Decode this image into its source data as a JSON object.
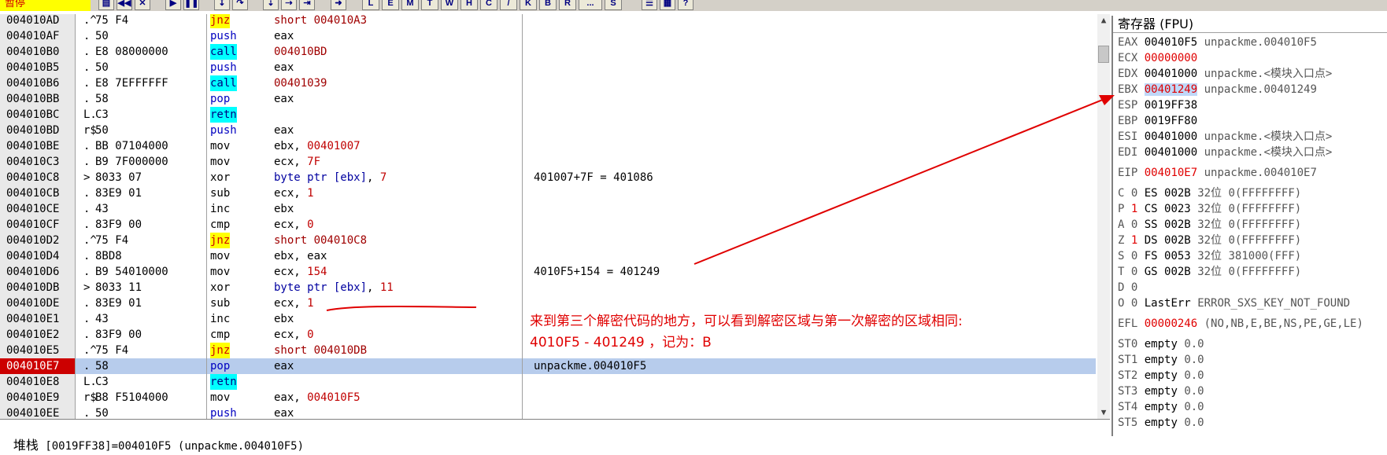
{
  "toolbar": {
    "status": "暂停",
    "letter_buttons": [
      "L",
      "E",
      "M",
      "T",
      "W",
      "H",
      "C",
      "/",
      "K",
      "B",
      "R",
      "...",
      "S"
    ]
  },
  "disasm": {
    "rows": [
      {
        "addr": "004010AD",
        "marker": ".^",
        "bytes": "75 F4",
        "mnem": "jnz",
        "ops": "short 004010A3",
        "comment": ""
      },
      {
        "addr": "004010AF",
        "marker": ".",
        "bytes": "50",
        "mnem": "push",
        "ops": "eax",
        "comment": ""
      },
      {
        "addr": "004010B0",
        "marker": ".",
        "bytes": "E8 08000000",
        "mnem": "call",
        "ops": "004010BD",
        "comment": ""
      },
      {
        "addr": "004010B5",
        "marker": ".",
        "bytes": "50",
        "mnem": "push",
        "ops": "eax",
        "comment": ""
      },
      {
        "addr": "004010B6",
        "marker": ".",
        "bytes": "E8 7EFFFFFF",
        "mnem": "call",
        "ops": "00401039",
        "comment": ""
      },
      {
        "addr": "004010BB",
        "marker": ".",
        "bytes": "58",
        "mnem": "pop",
        "ops": "eax",
        "comment": ""
      },
      {
        "addr": "004010BC",
        "marker": "L.",
        "bytes": "C3",
        "mnem": "retn",
        "ops": "",
        "comment": ""
      },
      {
        "addr": "004010BD",
        "marker": "r$",
        "bytes": "50",
        "mnem": "push",
        "ops": "eax",
        "comment": ""
      },
      {
        "addr": "004010BE",
        "marker": ".",
        "bytes": "BB 07104000",
        "mnem": "mov",
        "ops": "ebx, 00401007",
        "comment": ""
      },
      {
        "addr": "004010C3",
        "marker": ".",
        "bytes": "B9 7F000000",
        "mnem": "mov",
        "ops": "ecx, 7F",
        "comment": ""
      },
      {
        "addr": "004010C8",
        "marker": ">",
        "bytes": "8033 07",
        "mnem": "xor",
        "ops": "byte ptr [ebx], 7",
        "comment": "401007+7F = 401086"
      },
      {
        "addr": "004010CB",
        "marker": ".",
        "bytes": "83E9 01",
        "mnem": "sub",
        "ops": "ecx, 1",
        "comment": ""
      },
      {
        "addr": "004010CE",
        "marker": ".",
        "bytes": "43",
        "mnem": "inc",
        "ops": "ebx",
        "comment": ""
      },
      {
        "addr": "004010CF",
        "marker": ".",
        "bytes": "83F9 00",
        "mnem": "cmp",
        "ops": "ecx, 0",
        "comment": ""
      },
      {
        "addr": "004010D2",
        "marker": ".^",
        "bytes": "75 F4",
        "mnem": "jnz",
        "ops": "short 004010C8",
        "comment": ""
      },
      {
        "addr": "004010D4",
        "marker": ".",
        "bytes": "8BD8",
        "mnem": "mov",
        "ops": "ebx, eax",
        "comment": ""
      },
      {
        "addr": "004010D6",
        "marker": ".",
        "bytes": "B9 54010000",
        "mnem": "mov",
        "ops": "ecx, 154",
        "comment": "4010F5+154 = 401249"
      },
      {
        "addr": "004010DB",
        "marker": ">",
        "bytes": "8033 11",
        "mnem": "xor",
        "ops": "byte ptr [ebx], 11",
        "comment": ""
      },
      {
        "addr": "004010DE",
        "marker": ".",
        "bytes": "83E9 01",
        "mnem": "sub",
        "ops": "ecx, 1",
        "comment": ""
      },
      {
        "addr": "004010E1",
        "marker": ".",
        "bytes": "43",
        "mnem": "inc",
        "ops": "ebx",
        "comment": ""
      },
      {
        "addr": "004010E2",
        "marker": ".",
        "bytes": "83F9 00",
        "mnem": "cmp",
        "ops": "ecx, 0",
        "comment": ""
      },
      {
        "addr": "004010E5",
        "marker": ".^",
        "bytes": "75 F4",
        "mnem": "jnz",
        "ops": "short 004010DB",
        "comment": ""
      },
      {
        "addr": "004010E7",
        "marker": ".",
        "bytes": "58",
        "mnem": "pop",
        "ops": "eax",
        "comment": "unpackme.004010F5"
      },
      {
        "addr": "004010E8",
        "marker": "L.",
        "bytes": "C3",
        "mnem": "retn",
        "ops": "",
        "comment": ""
      },
      {
        "addr": "004010E9",
        "marker": "r$",
        "bytes": "B8 F5104000",
        "mnem": "mov",
        "ops": "eax, 004010F5",
        "comment": ""
      },
      {
        "addr": "004010EE",
        "marker": ".",
        "bytes": "50",
        "mnem": "push",
        "ops": "eax",
        "comment": ""
      }
    ],
    "current_addr": "004010E7"
  },
  "annotation": {
    "line1": "来到第三个解密代码的地方，可以看到解密区域与第一次解密的区域相同:",
    "line2": "4010F5 - 401249 ，记为：B"
  },
  "stack_info": {
    "label": "堆栈",
    "text": "[0019FF38]=004010F5 (unpackme.004010F5)"
  },
  "registers": {
    "title": "寄存器 (FPU)",
    "lines": [
      {
        "name": "EAX",
        "value": "004010F5",
        "desc": "unpackme.004010F5",
        "style": "dark"
      },
      {
        "name": "ECX",
        "value": "00000000",
        "desc": "",
        "style": "red"
      },
      {
        "name": "EDX",
        "value": "00401000",
        "desc": "unpackme.<模块入口点>",
        "style": "dark"
      },
      {
        "name": "EBX",
        "value": "00401249",
        "desc": "unpackme.00401249",
        "style": "box"
      },
      {
        "name": "ESP",
        "value": "0019FF38",
        "desc": "",
        "style": "dark"
      },
      {
        "name": "EBP",
        "value": "0019FF80",
        "desc": "",
        "style": "dark"
      },
      {
        "name": "ESI",
        "value": "00401000",
        "desc": "unpackme.<模块入口点>",
        "style": "dark"
      },
      {
        "name": "EDI",
        "value": "00401000",
        "desc": "unpackme.<模块入口点>",
        "style": "dark"
      },
      {
        "name": "EIP",
        "value": "004010E7",
        "desc": "unpackme.004010E7",
        "style": "red"
      },
      {
        "name": "C 0",
        "value": "ES 002B",
        "desc": "32位 0(FFFFFFFF)",
        "style": "dark"
      },
      {
        "name": "P 1",
        "value": "CS 0023",
        "desc": "32位 0(FFFFFFFF)",
        "style": "flagred"
      },
      {
        "name": "A 0",
        "value": "SS 002B",
        "desc": "32位 0(FFFFFFFF)",
        "style": "dark"
      },
      {
        "name": "Z 1",
        "value": "DS 002B",
        "desc": "32位 0(FFFFFFFF)",
        "style": "flagred"
      },
      {
        "name": "S 0",
        "value": "FS 0053",
        "desc": "32位 381000(FFF)",
        "style": "dark"
      },
      {
        "name": "T 0",
        "value": "GS 002B",
        "desc": "32位 0(FFFFFFFF)",
        "style": "dark"
      },
      {
        "name": "D 0",
        "value": "",
        "desc": "",
        "style": "dark"
      },
      {
        "name": "O 0",
        "value": "LastErr",
        "desc": "ERROR_SXS_KEY_NOT_FOUND",
        "style": "dark"
      },
      {
        "name": "EFL",
        "value": "00000246",
        "desc": "(NO,NB,E,BE,NS,PE,GE,LE)",
        "style": "red"
      },
      {
        "name": "ST0",
        "value": "empty",
        "desc": "0.0",
        "style": "dark"
      },
      {
        "name": "ST1",
        "value": "empty",
        "desc": "0.0",
        "style": "dark"
      },
      {
        "name": "ST2",
        "value": "empty",
        "desc": "0.0",
        "style": "dark"
      },
      {
        "name": "ST3",
        "value": "empty",
        "desc": "0.0",
        "style": "dark"
      },
      {
        "name": "ST4",
        "value": "empty",
        "desc": "0.0",
        "style": "dark"
      },
      {
        "name": "ST5",
        "value": "empty",
        "desc": "0.0",
        "style": "dark"
      }
    ]
  },
  "colors": {
    "annotation": "#e00000",
    "current_row": "#b7ccec",
    "jump_bg": "#ffff00",
    "call_bg": "#00ffff"
  }
}
